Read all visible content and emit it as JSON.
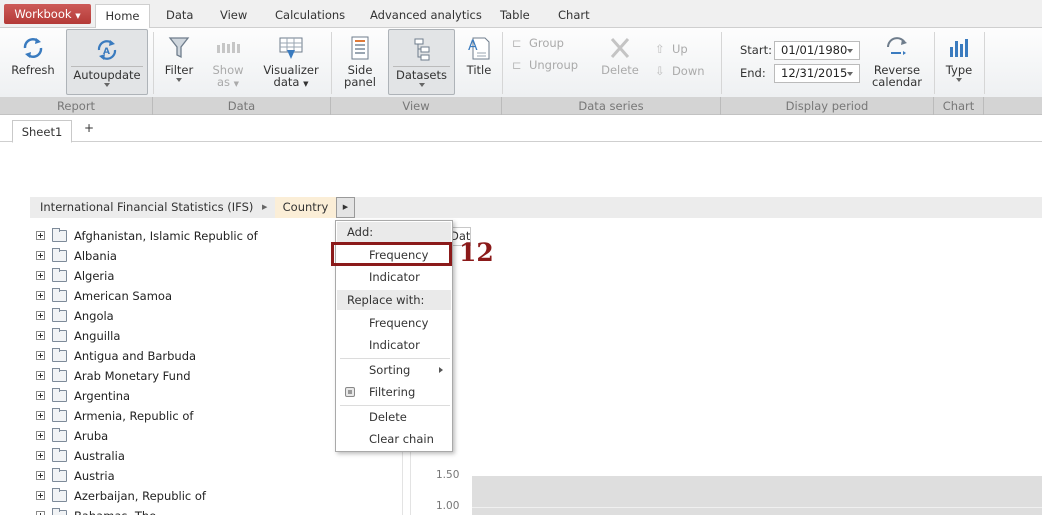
{
  "menu_tabs": {
    "workbook": "Workbook",
    "home": "Home",
    "data": "Data",
    "view": "View",
    "calculations": "Calculations",
    "advanced": "Advanced analytics",
    "table": "Table",
    "chart": "Chart"
  },
  "ribbon": {
    "refresh": "Refresh",
    "autoupdate": "Autoupdate",
    "filter": "Filter",
    "show_as_1": "Show",
    "show_as_2": "as",
    "visualizer_1": "Visualizer",
    "visualizer_2": "data",
    "side_1": "Side",
    "side_2": "panel",
    "datasets": "Datasets",
    "title": "Title",
    "group": "Group",
    "ungroup": "Ungroup",
    "delete": "Delete",
    "up": "Up",
    "down": "Down",
    "start_label": "Start:",
    "start_value": "01/01/1980",
    "end_label": "End:",
    "end_value": "12/31/2015",
    "reverse_1": "Reverse",
    "reverse_2": "calendar",
    "type": "Type"
  },
  "group_labels": {
    "report": "Report",
    "data": "Data",
    "view": "View",
    "data_series": "Data series",
    "display_period": "Display period",
    "chart": "Chart"
  },
  "sheet": {
    "tab": "Sheet1",
    "add": "+"
  },
  "breadcrumb": {
    "source": "International Financial Statistics (IFS)",
    "current": "Country"
  },
  "countries": [
    "Afghanistan, Islamic Republic of",
    "Albania",
    "Algeria",
    "American Samoa",
    "Angola",
    "Anguilla",
    "Antigua and Barbuda",
    "Arab Monetary Fund",
    "Argentina",
    "Armenia, Republic of",
    "Aruba",
    "Australia",
    "Austria",
    "Azerbaijan, Republic of",
    "Bahamas, The"
  ],
  "background_tab": "Data",
  "axis": {
    "tick1": "1.50",
    "tick2": "1.00"
  },
  "context_menu": {
    "add_header": "Add:",
    "add_frequency": "Frequency",
    "add_indicator": "Indicator",
    "replace_header": "Replace with:",
    "replace_frequency": "Frequency",
    "replace_indicator": "Indicator",
    "sorting": "Sorting",
    "filtering": "Filtering",
    "delete": "Delete",
    "clear_chain": "Clear chain"
  },
  "annotation": {
    "step": "12"
  },
  "colors": {
    "accent": "#8b1a1a",
    "workbook": "#c0504d",
    "icon_blue": "#3a7bbf"
  }
}
